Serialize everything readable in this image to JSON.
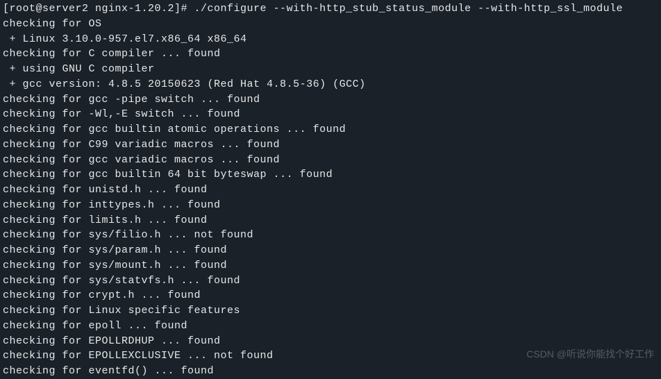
{
  "terminal": {
    "lines": [
      "[root@server2 nginx-1.20.2]# ./configure --with-http_stub_status_module --with-http_ssl_module",
      "checking for OS",
      " + Linux 3.10.0-957.el7.x86_64 x86_64",
      "checking for C compiler ... found",
      " + using GNU C compiler",
      " + gcc version: 4.8.5 20150623 (Red Hat 4.8.5-36) (GCC)",
      "checking for gcc -pipe switch ... found",
      "checking for -Wl,-E switch ... found",
      "checking for gcc builtin atomic operations ... found",
      "checking for C99 variadic macros ... found",
      "checking for gcc variadic macros ... found",
      "checking for gcc builtin 64 bit byteswap ... found",
      "checking for unistd.h ... found",
      "checking for inttypes.h ... found",
      "checking for limits.h ... found",
      "checking for sys/filio.h ... not found",
      "checking for sys/param.h ... found",
      "checking for sys/mount.h ... found",
      "checking for sys/statvfs.h ... found",
      "checking for crypt.h ... found",
      "checking for Linux specific features",
      "checking for epoll ... found",
      "checking for EPOLLRDHUP ... found",
      "checking for EPOLLEXCLUSIVE ... not found",
      "checking for eventfd() ... found"
    ]
  },
  "watermark": {
    "text": "CSDN @听说你能找个好工作"
  }
}
